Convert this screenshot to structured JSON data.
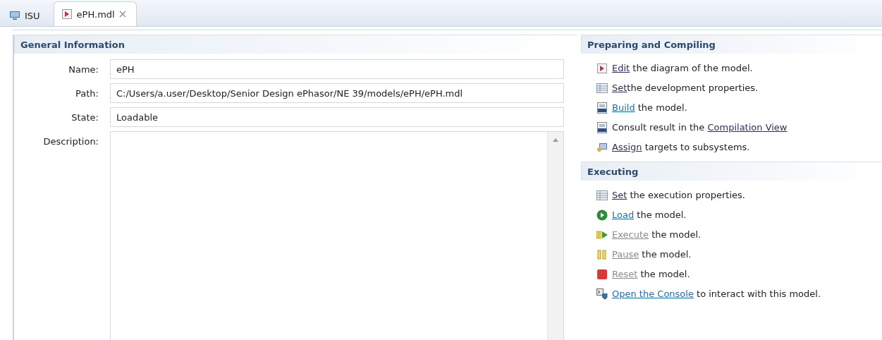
{
  "tabs": [
    {
      "label": "ISU",
      "kind": "monitor",
      "selected": false,
      "closable": false
    },
    {
      "label": "ePH.mdl",
      "kind": "diagram",
      "selected": true,
      "closable": true
    }
  ],
  "general": {
    "title": "General Information",
    "fields": [
      {
        "label": "Name:",
        "value": "ePH",
        "kind": "line"
      },
      {
        "label": "Path:",
        "value": "C:/Users/a.user/Desktop/Senior Design ePhasor/NE 39/models/ePH/ePH.mdl",
        "kind": "line"
      },
      {
        "label": "State:",
        "value": "Loadable",
        "kind": "line"
      },
      {
        "label": "Description:",
        "kind": "area"
      }
    ]
  },
  "sections": [
    {
      "title": "Preparing and Compiling",
      "actions": [
        {
          "kind": "diagram",
          "link": "Edit",
          "after": " the diagram of the model.",
          "visited": true,
          "disabled": false
        },
        {
          "kind": "table",
          "link": "Set",
          "after": "the development properties.",
          "visited": true,
          "disabled": false
        },
        {
          "kind": "binary",
          "link": "Build",
          "after": " the model.",
          "visited": false,
          "disabled": false
        },
        {
          "kind": "binary",
          "before": "Consult result in the ",
          "link": "Compilation View",
          "visited": true,
          "disabled": false
        },
        {
          "kind": "assign",
          "link": "Assign",
          "after": " targets to subsystems.",
          "visited": true,
          "disabled": false
        }
      ]
    },
    {
      "title": "Executing",
      "actions": [
        {
          "kind": "table",
          "link": "Set",
          "after": " the execution properties.",
          "visited": true,
          "disabled": false
        },
        {
          "kind": "load",
          "link": "Load",
          "after": " the model.",
          "visited": false,
          "disabled": false
        },
        {
          "kind": "execute",
          "link": "Execute",
          "after": " the model.",
          "disabled": true
        },
        {
          "kind": "pause",
          "link": "Pause",
          "after": " the model.",
          "disabled": true
        },
        {
          "kind": "reset",
          "link": "Reset",
          "after": " the model.",
          "disabled": true
        },
        {
          "kind": "console",
          "link": "Open the Console",
          "after": " to interact with this model.",
          "visited": false,
          "disabled": false
        }
      ]
    }
  ]
}
